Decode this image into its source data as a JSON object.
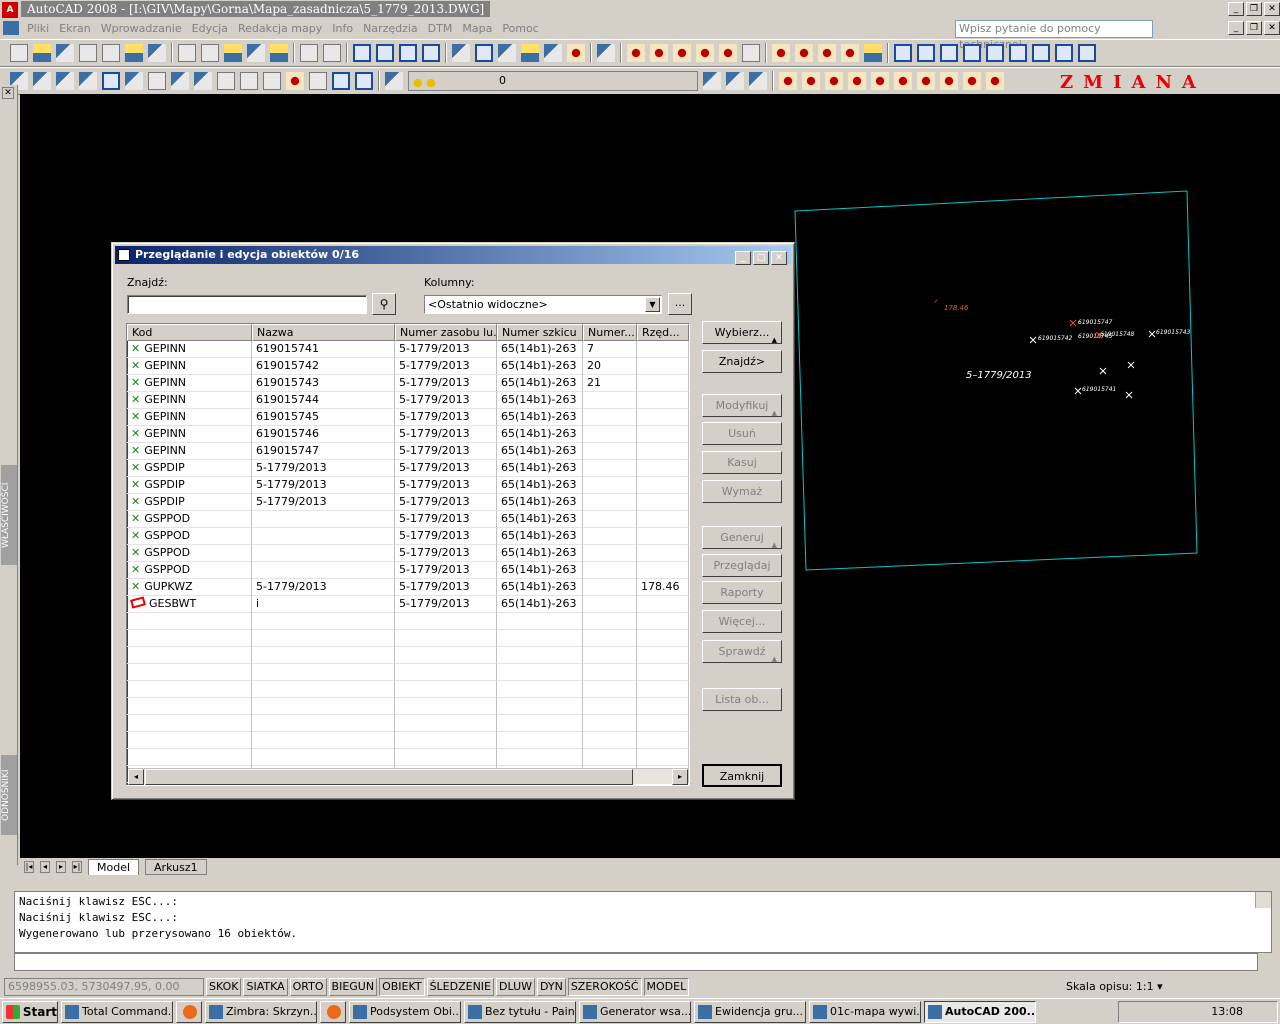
{
  "window": {
    "title": "AutoCAD 2008 - [I:\\GIV\\Mapy\\Gorna\\Mapa_zasadnicza\\5_1779_2013.DWG]"
  },
  "menu": [
    "Pliki",
    "Ekran",
    "Wprowadzanie",
    "Edycja",
    "Redakcja mapy",
    "Info",
    "Narzędzia",
    "DTM",
    "Mapa",
    "Pomoc"
  ],
  "help_placeholder": "Wpisz pytanie do pomocy technicznej",
  "layer": {
    "value": "0"
  },
  "zmiana": "ZMIANA",
  "side_tabs": {
    "properties": "WŁAŚCIWOŚCI",
    "references": "ODNOŚNIKI"
  },
  "layout_tabs": [
    "Model",
    "Arkusz1"
  ],
  "command_history": [
    "Naciśnij klawisz ESC...:",
    "Naciśnij klawisz ESC...:",
    "Wygenerowano lub przerysowano 16 obiektów."
  ],
  "status": {
    "coords": "6598955.03, 5730497.95, 0.00",
    "buttons": [
      {
        "label": "SKOK",
        "on": false
      },
      {
        "label": "SIATKA",
        "on": false
      },
      {
        "label": "ORTO",
        "on": false
      },
      {
        "label": "BIEGUN",
        "on": false
      },
      {
        "label": "OBIEKT",
        "on": true
      },
      {
        "label": "ŚLEDZENIE",
        "on": false
      },
      {
        "label": "DLUW",
        "on": false
      },
      {
        "label": "DYN",
        "on": false
      },
      {
        "label": "SZEROKOŚĆ",
        "on": true
      },
      {
        "label": "MODEL",
        "on": true
      }
    ],
    "scale_label": "Skala opisu:",
    "scale_value": "1:1"
  },
  "taskbar": {
    "start": "Start",
    "tasks": [
      "Total Command...",
      "",
      "Zimbra: Skrzyn...",
      "",
      "Podsystem Obi...",
      "Bez tytułu - Paint",
      "Generator wsa...",
      "Ewidencja gru...",
      "01c-mapa wywi...",
      "AutoCAD 200..."
    ],
    "active_index": 9,
    "clock": "13:08"
  },
  "dialog": {
    "title": "Przeglądanie i edycja obiektów  0/16",
    "find_label": "Znajdź:",
    "find_value": "",
    "columns_label": "Kolumny:",
    "columns_value": "<Ostatnio widoczne>",
    "dots": "...",
    "headers": [
      "Kod",
      "Nazwa",
      "Numer zasobu lu...",
      "Numer szkicu",
      "Numer...",
      "Rzęd..."
    ],
    "rows": [
      {
        "ok": true,
        "kod": "GEPINN",
        "nazwa": "619015741",
        "zasob": "5-1779/2013",
        "szkic": "65(14b1)-263",
        "numer": "7",
        "rzedna": ""
      },
      {
        "ok": true,
        "kod": "GEPINN",
        "nazwa": "619015742",
        "zasob": "5-1779/2013",
        "szkic": "65(14b1)-263",
        "numer": "20",
        "rzedna": ""
      },
      {
        "ok": true,
        "kod": "GEPINN",
        "nazwa": "619015743",
        "zasob": "5-1779/2013",
        "szkic": "65(14b1)-263",
        "numer": "21",
        "rzedna": ""
      },
      {
        "ok": true,
        "kod": "GEPINN",
        "nazwa": "619015744",
        "zasob": "5-1779/2013",
        "szkic": "65(14b1)-263",
        "numer": "",
        "rzedna": ""
      },
      {
        "ok": true,
        "kod": "GEPINN",
        "nazwa": "619015745",
        "zasob": "5-1779/2013",
        "szkic": "65(14b1)-263",
        "numer": "",
        "rzedna": ""
      },
      {
        "ok": true,
        "kod": "GEPINN",
        "nazwa": "619015746",
        "zasob": "5-1779/2013",
        "szkic": "65(14b1)-263",
        "numer": "",
        "rzedna": ""
      },
      {
        "ok": true,
        "kod": "GEPINN",
        "nazwa": "619015747",
        "zasob": "5-1779/2013",
        "szkic": "65(14b1)-263",
        "numer": "",
        "rzedna": ""
      },
      {
        "ok": true,
        "kod": "GSPDIP",
        "nazwa": "5-1779/2013",
        "zasob": "5-1779/2013",
        "szkic": "65(14b1)-263",
        "numer": "",
        "rzedna": ""
      },
      {
        "ok": true,
        "kod": "GSPDIP",
        "nazwa": "5-1779/2013",
        "zasob": "5-1779/2013",
        "szkic": "65(14b1)-263",
        "numer": "",
        "rzedna": ""
      },
      {
        "ok": true,
        "kod": "GSPDIP",
        "nazwa": "5-1779/2013",
        "zasob": "5-1779/2013",
        "szkic": "65(14b1)-263",
        "numer": "",
        "rzedna": ""
      },
      {
        "ok": true,
        "kod": "GSPPOD",
        "nazwa": "",
        "zasob": "5-1779/2013",
        "szkic": "65(14b1)-263",
        "numer": "",
        "rzedna": ""
      },
      {
        "ok": true,
        "kod": "GSPPOD",
        "nazwa": "",
        "zasob": "5-1779/2013",
        "szkic": "65(14b1)-263",
        "numer": "",
        "rzedna": ""
      },
      {
        "ok": true,
        "kod": "GSPPOD",
        "nazwa": "",
        "zasob": "5-1779/2013",
        "szkic": "65(14b1)-263",
        "numer": "",
        "rzedna": ""
      },
      {
        "ok": true,
        "kod": "GSPPOD",
        "nazwa": "",
        "zasob": "5-1779/2013",
        "szkic": "65(14b1)-263",
        "numer": "",
        "rzedna": ""
      },
      {
        "ok": true,
        "kod": "GUPKWZ",
        "nazwa": "5-1779/2013",
        "zasob": "5-1779/2013",
        "szkic": "65(14b1)-263",
        "numer": "",
        "rzedna": "178.46"
      },
      {
        "ok": false,
        "kod": "GESBWT",
        "nazwa": "i",
        "zasob": "5-1779/2013",
        "szkic": "65(14b1)-263",
        "numer": "",
        "rzedna": ""
      }
    ],
    "buttons": [
      {
        "label": "Wybierz...",
        "enabled": true,
        "menu": true
      },
      {
        "label": "Znajdź>",
        "enabled": true,
        "menu": false
      },
      {
        "label": "Modyfikuj au...",
        "enabled": false,
        "menu": true
      },
      {
        "label": "Usuń",
        "enabled": false,
        "menu": false
      },
      {
        "label": "Kasuj",
        "enabled": false,
        "menu": false
      },
      {
        "label": "Wymaż",
        "enabled": false,
        "menu": false
      },
      {
        "label": "Generuj",
        "enabled": false,
        "menu": true
      },
      {
        "label": "Przeglądaj",
        "enabled": false,
        "menu": false
      },
      {
        "label": "Raporty",
        "enabled": false,
        "menu": false
      },
      {
        "label": "Więcej...",
        "enabled": false,
        "menu": false
      },
      {
        "label": "Sprawdź",
        "enabled": false,
        "menu": true
      },
      {
        "label": "Lista ob...",
        "enabled": false,
        "menu": false
      }
    ],
    "close": "Zamknij"
  },
  "drawing": {
    "sketch_label": "5–1779/2013",
    "height_label": "178.46",
    "point_labels": [
      "619015747",
      "619015748",
      "619015743",
      "619015742",
      "619015745",
      "619015741"
    ]
  }
}
